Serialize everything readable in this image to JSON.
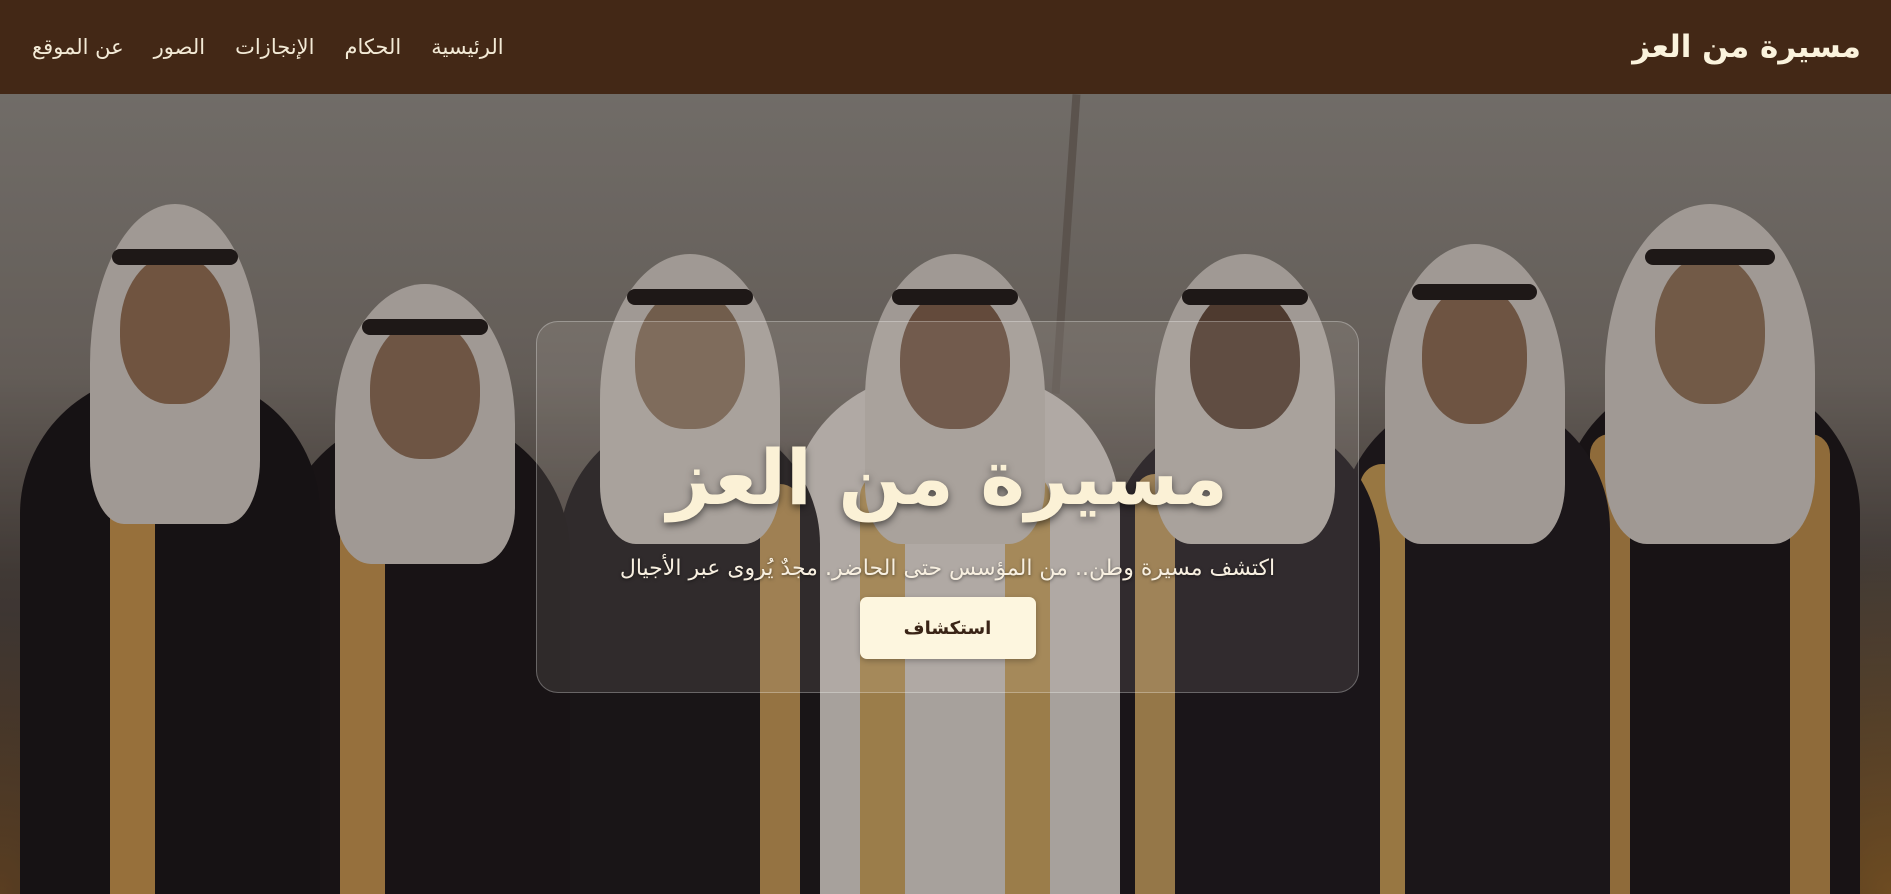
{
  "header": {
    "brand": "مسيرة من العز",
    "nav": [
      {
        "label": "الرئيسية"
      },
      {
        "label": "الحكام"
      },
      {
        "label": "الإنجازات"
      },
      {
        "label": "الصور"
      },
      {
        "label": "عن الموقع"
      }
    ]
  },
  "hero": {
    "image": "group-portrait-of-saudi-kings",
    "title": "مسيرة من العز",
    "subtitle": "اكتشف مسيرة وطن.. من المؤسس حتى الحاضر. مجدٌ يُروى عبر الأجيال",
    "cta_label": "استكشاف"
  },
  "colors": {
    "navbar_bg": "#432816",
    "text_light": "#fbf1d6",
    "button_bg": "#fdf6df",
    "button_text": "#3a2416"
  }
}
